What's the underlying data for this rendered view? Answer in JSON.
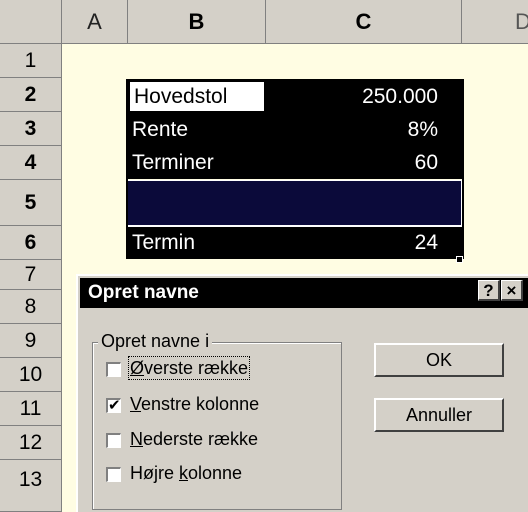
{
  "columns": {
    "corner": "",
    "a": "A",
    "b": "B",
    "c": "C",
    "d": "D"
  },
  "rows": [
    "1",
    "2",
    "3",
    "4",
    "5",
    "6",
    "7",
    "8",
    "9",
    "10",
    "11",
    "12",
    "13"
  ],
  "cells": {
    "b2": "Hovedstol",
    "c2": "250.000",
    "b3": "Rente",
    "c3": "8%",
    "b4": "Terminer",
    "c4": "60",
    "b6": "Termin",
    "c6": "24"
  },
  "dialog": {
    "title": "Opret navne",
    "help_label": "?",
    "close_label": "×",
    "group_label": "Opret navne i",
    "options": [
      {
        "pre": "",
        "accel": "Ø",
        "post": "verste række",
        "checked": false
      },
      {
        "pre": "",
        "accel": "V",
        "post": "enstre kolonne",
        "checked": true
      },
      {
        "pre": "",
        "accel": "N",
        "post": "ederste række",
        "checked": false
      },
      {
        "pre": "Højre ",
        "accel": "k",
        "post": "olonne",
        "checked": false
      }
    ],
    "ok_label": "OK",
    "cancel_label": "Annuller"
  },
  "colors": {
    "sheet_bg": "#fffde3",
    "selection": "#000000",
    "dialog_bg": "#d4d0c8",
    "title_bar": "#000000"
  }
}
